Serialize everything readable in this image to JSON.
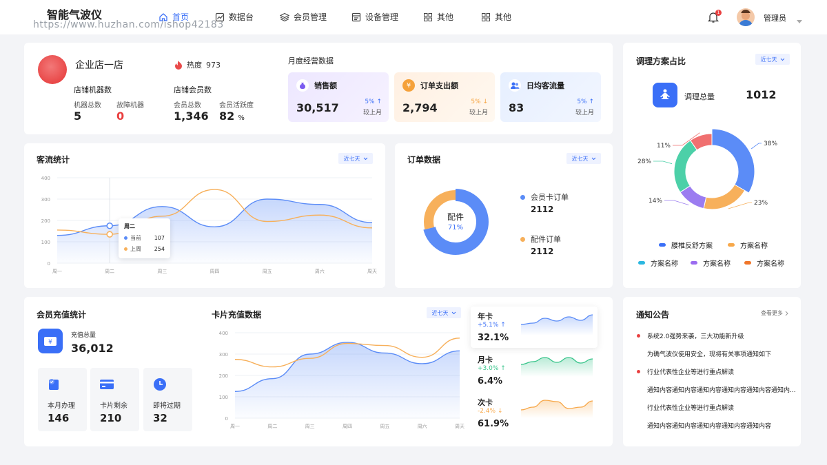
{
  "header": {
    "app_title": "智能气波仪",
    "watermark": "https://www.huzhan.com/ishop42183",
    "nav": [
      {
        "label": "首页",
        "icon": "home-icon"
      },
      {
        "label": "数据台",
        "icon": "dashboard-icon"
      },
      {
        "label": "会员管理",
        "icon": "layers-icon"
      },
      {
        "label": "设备管理",
        "icon": "device-icon"
      },
      {
        "label": "其他",
        "icon": "grid-icon"
      },
      {
        "label": "其他",
        "icon": "grid-icon"
      }
    ],
    "notification_badge": "1",
    "user_name": "管理员"
  },
  "store": {
    "name": "企业店一店",
    "heat_label": "热度",
    "heat_value": "973",
    "machines_title": "店铺机器数",
    "machines_total_label": "机器总数",
    "machines_total": "5",
    "machines_fault_label": "故障机器",
    "machines_fault": "0",
    "members_title": "店铺会员数",
    "members_total_label": "会员总数",
    "members_total": "1,346",
    "members_active_label": "会员活跃度",
    "members_active": "82",
    "members_active_unit": "%"
  },
  "monthly": {
    "title": "月度经营数据",
    "compare_label": "较上月",
    "items": [
      {
        "label": "销售额",
        "value": "30,517",
        "change": "5% ↑",
        "color": "#7b5cf0"
      },
      {
        "label": "订单支出额",
        "value": "2,794",
        "change": "5% ↓",
        "color": "#f5a13a"
      },
      {
        "label": "日均客流量",
        "value": "83",
        "change": "5% ↑",
        "color": "#3a6ff7"
      }
    ]
  },
  "traffic": {
    "title": "客流统计",
    "range": "近七天",
    "tooltip": {
      "day": "周二",
      "current_label": "当前",
      "current_value": "107",
      "last_label": "上周",
      "last_value": "254"
    }
  },
  "orders": {
    "title": "订单数据",
    "range": "近七天",
    "center_label": "配件",
    "center_value": "71%",
    "legend": [
      {
        "label": "会员卡订单",
        "value": "2112",
        "color": "#5b8cf7"
      },
      {
        "label": "配件订单",
        "value": "2112",
        "color": "#f7b05b"
      }
    ]
  },
  "plan": {
    "title": "调理方案占比",
    "range": "近七天",
    "total_label": "调理总量",
    "total_value": "1012",
    "slices": [
      {
        "label": "38%",
        "value": 38,
        "color": "#5b8cf7"
      },
      {
        "label": "23%",
        "value": 23,
        "color": "#f7b05b"
      },
      {
        "label": "14%",
        "value": 14,
        "color": "#9b7cf0"
      },
      {
        "label": "28%",
        "value": 28,
        "color": "#4cd0a8"
      },
      {
        "label": "11%",
        "value": 11,
        "color": "#f07070"
      }
    ],
    "legend": [
      {
        "label": "腰椎反舒方案",
        "color": "#3a6ff7"
      },
      {
        "label": "方案名称",
        "color": "#f7a84a"
      },
      {
        "label": "方案名称",
        "color": "#2bb7e0"
      },
      {
        "label": "方案名称",
        "color": "#9b6cf0"
      },
      {
        "label": "方案名称",
        "color": "#f0762a"
      }
    ]
  },
  "recharge": {
    "title": "会员充值统计",
    "total_label": "充值总量",
    "total_value": "36,012",
    "tiles": [
      {
        "label": "本月办理",
        "value": "146",
        "icon": "card-check-icon"
      },
      {
        "label": "卡片剩余",
        "value": "210",
        "icon": "card-icon"
      },
      {
        "label": "即将过期",
        "value": "32",
        "icon": "clock-icon"
      }
    ]
  },
  "card_recharge": {
    "title": "卡片充值数据",
    "range": "近七天"
  },
  "card_types": [
    {
      "name": "年卡",
      "change": "+5.1% ↑",
      "value": "32.1%",
      "color": "#5b8cf7",
      "change_color": "#3a6ff7"
    },
    {
      "name": "月卡",
      "change": "+3.0% ↑",
      "value": "6.4%",
      "color": "#37c48a",
      "change_color": "#37c48a"
    },
    {
      "name": "次卡",
      "change": "-2.4% ↓",
      "value": "61.9%",
      "color": "#f7a84a",
      "change_color": "#f7a84a"
    }
  ],
  "notice": {
    "title": "通知公告",
    "more": "查看更多",
    "items": [
      {
        "text": "系统2.0强势来袭，三大功能新升级",
        "dot": true
      },
      {
        "text": "为确气波仪使用安全，现将有关事项通知如下",
        "dot": false
      },
      {
        "text": "行业代表性企业等进行重点解读",
        "dot": true
      },
      {
        "text": "通知内容通知内容通知内容通知内容通知内容通知内...",
        "dot": false
      },
      {
        "text": "行业代表性企业等进行重点解读",
        "dot": false
      },
      {
        "text": "通知内容通知内容通知内容通知内容通知内容",
        "dot": false
      }
    ]
  },
  "chart_data": [
    {
      "type": "line",
      "title": "客流统计",
      "categories": [
        "周一",
        "周二",
        "周三",
        "周四",
        "周五",
        "周六",
        "周天"
      ],
      "ylim": [
        0,
        400
      ],
      "yticks": [
        "0",
        "100",
        "200",
        "300",
        "400"
      ],
      "series": [
        {
          "name": "当前",
          "values": [
            130,
            175,
            265,
            170,
            300,
            275,
            190
          ],
          "color": "#5b8cf7"
        },
        {
          "name": "上周",
          "values": [
            155,
            135,
            220,
            345,
            195,
            225,
            165
          ],
          "color": "#f7b05b"
        }
      ]
    },
    {
      "type": "pie",
      "title": "订单数据",
      "slices": [
        {
          "label": "会员卡订单",
          "value": 71
        },
        {
          "label": "配件订单",
          "value": 29
        }
      ]
    },
    {
      "type": "pie",
      "title": "调理方案占比",
      "slices": [
        38,
        23,
        14,
        28,
        11
      ]
    },
    {
      "type": "line",
      "title": "卡片充值数据",
      "categories": [
        "周一",
        "周二",
        "周三",
        "周四",
        "周五",
        "周六",
        "周天"
      ],
      "ylim": [
        0,
        400
      ],
      "yticks": [
        "0",
        "100",
        "200",
        "300",
        "400"
      ],
      "series": [
        {
          "values": [
            125,
            185,
            300,
            355,
            305,
            255,
            315
          ],
          "color": "#5b8cf7"
        },
        {
          "values": [
            275,
            240,
            280,
            350,
            340,
            285,
            375
          ],
          "color": "#f7b05b"
        }
      ]
    }
  ]
}
